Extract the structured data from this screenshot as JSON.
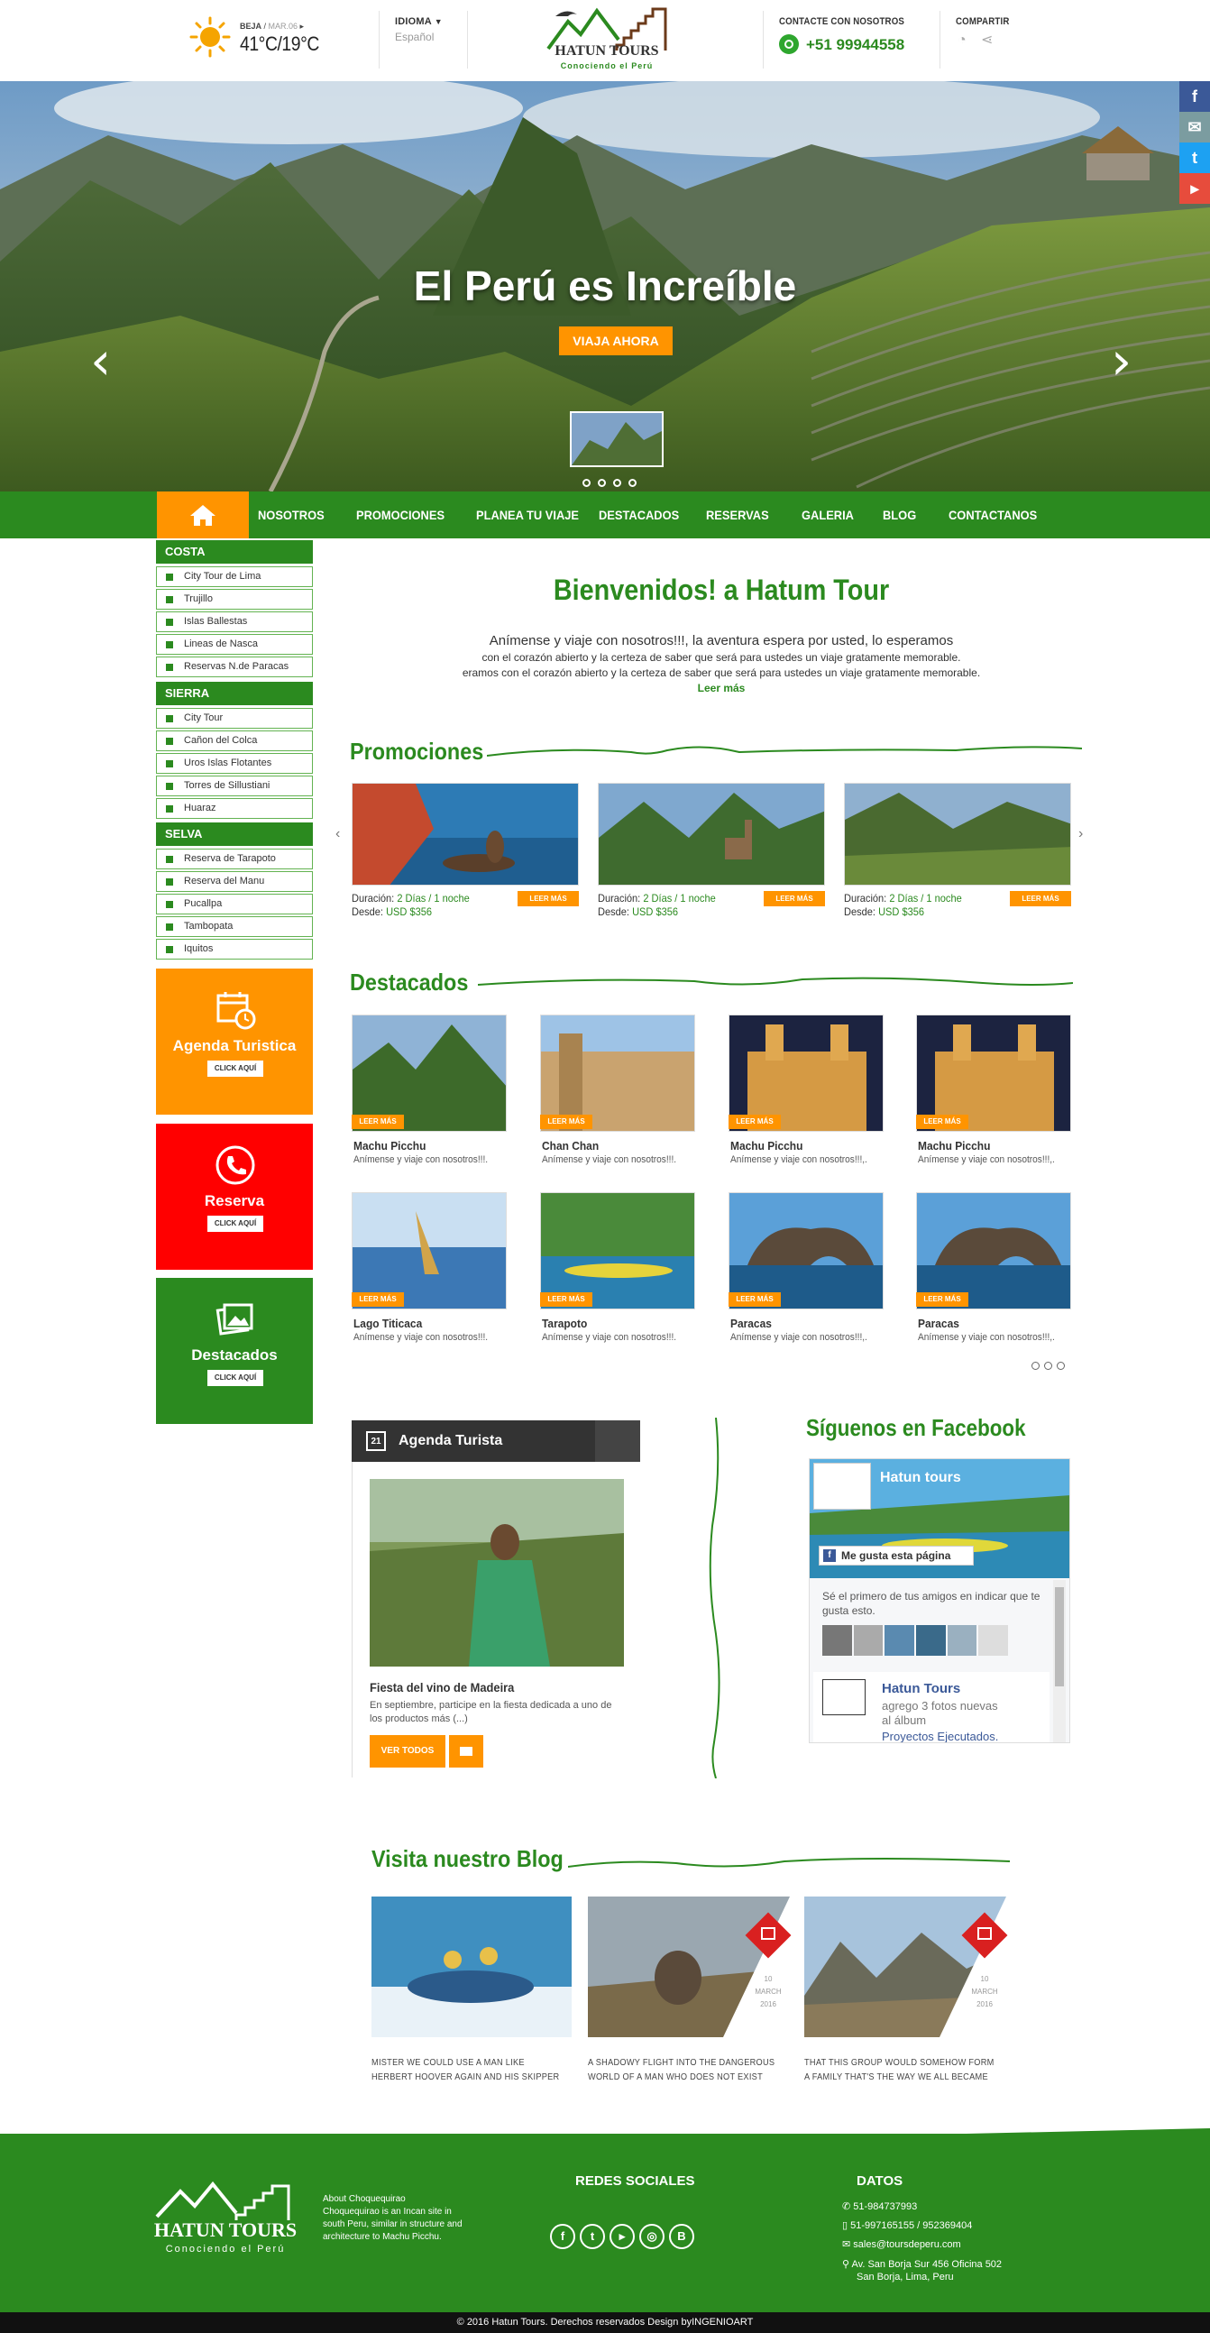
{
  "header": {
    "weather_location": "BEJA",
    "weather_date": "MAR.06",
    "weather_temp": "41°C/19°C",
    "language_label": "IDIOMA",
    "language_value": "Español",
    "logo_name": "HATUN TOURS",
    "logo_tagline": "Conociendo el Perú",
    "contact_label": "CONTACTE CON NOSOTROS",
    "contact_phone": "+51 99944558",
    "share_label": "COMPARTIR"
  },
  "hero": {
    "title": "El Perú es Increíble",
    "button": "VIAJA AHORA",
    "slides": 4
  },
  "nav": {
    "items": [
      "NOSOTROS",
      "PROMOCIONES",
      "PLANEA TU VIAJE",
      "DESTACADOS",
      "RESERVAS",
      "GALERIA",
      "BLOG",
      "CONTACTANOS"
    ]
  },
  "sidebar": {
    "sections": [
      {
        "title": "COSTA",
        "items": [
          "City Tour de Lima",
          "Trujillo",
          "Islas Ballestas",
          "Lineas de Nasca",
          "Reservas N.de Paracas"
        ]
      },
      {
        "title": "SIERRA",
        "items": [
          "City Tour",
          "Cañon del Colca",
          "Uros Islas Flotantes",
          "Torres de Sillustiani",
          "Huaraz"
        ]
      },
      {
        "title": "SELVA",
        "items": [
          "Reserva de Tarapoto",
          "Reserva del Manu",
          "Pucallpa",
          "Tambopata",
          "Iquitos"
        ]
      }
    ],
    "boxes": [
      {
        "title": "Agenda Turistica",
        "button": "CLICK AQUÍ",
        "color": "#ff9400"
      },
      {
        "title": "Reserva",
        "button": "CLICK AQUÍ",
        "color": "#ff0000"
      },
      {
        "title": "Destacados",
        "button": "CLICK AQUÍ",
        "color": "#2b8a1f"
      }
    ]
  },
  "welcome": {
    "title": "Bienvenidos! a Hatum Tour",
    "line1": "Anímense y viaje con nosotros!!!, la aventura espera por usted, lo esperamos",
    "line2": "con el corazón abierto y la certeza de saber que será para ustedes un viaje gratamente memorable.",
    "line3": "eramos con el corazón abierto y la certeza de saber que será para ustedes un viaje gratamente memorable.",
    "more": "Leer más"
  },
  "promociones": {
    "title": "Promociones",
    "items": [
      {
        "duracion_label": "Duración:",
        "duracion": "2 Días / 1 noche",
        "desde_label": "Desde:",
        "precio": "USD $356",
        "button": "LEER MÁS"
      },
      {
        "duracion_label": "Duración:",
        "duracion": "2 Días / 1 noche",
        "desde_label": "Desde:",
        "precio": "USD $356",
        "button": "LEER MÁS"
      },
      {
        "duracion_label": "Duración:",
        "duracion": "2 Días / 1 noche",
        "desde_label": "Desde:",
        "precio": "USD $356",
        "button": "LEER MÁS"
      }
    ]
  },
  "destacados": {
    "title": "Destacados",
    "items": [
      {
        "title": "Machu Picchu",
        "text": "Anímense y viaje con nosotros!!!.",
        "button": "LEER MÁS"
      },
      {
        "title": "Chan Chan",
        "text": "Anímense y viaje con nosotros!!!.",
        "button": "LEER MÁS"
      },
      {
        "title": "Machu Picchu",
        "text": "Anímense y viaje con nosotros!!!,.",
        "button": "LEER MÁS"
      },
      {
        "title": "Machu Picchu",
        "text": "Anímense y viaje con nosotros!!!,.",
        "button": "LEER MÁS"
      },
      {
        "title": "Lago Titicaca",
        "text": "Anímense y viaje con nosotros!!!.",
        "button": "LEER MÁS"
      },
      {
        "title": "Tarapoto",
        "text": "Anímense y viaje con nosotros!!!.",
        "button": "LEER MÁS"
      },
      {
        "title": "Paracas",
        "text": "Anímense y viaje con nosotros!!!,.",
        "button": "LEER MÁS"
      },
      {
        "title": "Paracas",
        "text": "Anímense y viaje con nosotros!!!,.",
        "button": "LEER MÁS"
      }
    ]
  },
  "agenda": {
    "title": "Agenda Turista",
    "day": "21",
    "event_title": "Fiesta del vino de Madeira",
    "event_text": "En septiembre, participe en la fiesta dedicada a uno de los productos más (...)",
    "button": "VER TODOS"
  },
  "facebook": {
    "title": "Síguenos en Facebook",
    "page_name": "Hatun tours",
    "like": "Me gusta esta página",
    "friends": "Sé el primero de tus amigos en indicar que te gusta esto.",
    "post_author": "Hatun Tours",
    "post_text": "agrego 3 fotos nuevas al álbum",
    "post_link": "Proyectos Ejecutados."
  },
  "blog": {
    "title": "Visita nuestro Blog",
    "posts": [
      {
        "caption": "MISTER WE COULD USE A MAN LIKE HERBERT HOOVER AGAIN AND HIS SKIPPER"
      },
      {
        "caption": "A SHADOWY FLIGHT INTO THE DANGEROUS WORLD OF A MAN WHO DOES NOT EXIST",
        "day": "10",
        "month": "MARCH",
        "year": "2016"
      },
      {
        "caption": "THAT THIS GROUP WOULD SOMEHOW FORM A FAMILY THAT'S THE WAY WE ALL BECAME",
        "day": "10",
        "month": "MARCH",
        "year": "2016"
      }
    ]
  },
  "footer": {
    "logo_name": "HATUN TOURS",
    "logo_tagline": "Conociendo el Perú",
    "about_title": "About Choquequirao",
    "about_text": "Choquequirao is an Incan site in south Peru, similar in structure and architecture to Machu Picchu.",
    "redes_title": "REDES SOCIALES",
    "datos_title": "DATOS",
    "phone1": "51-984737993",
    "phone2": "51-997165155 / 952369404",
    "email": "sales@toursdeperu.com",
    "address1": "Av. San Borja Sur 456 Oficina 502",
    "address2": "San Borja, Lima, Peru",
    "copyright": "© 2016  Hatun Tours. Derechos reservados Design byINGENIOART"
  },
  "colors": {
    "green": "#2b8a1f",
    "orange": "#ff9400",
    "red": "#ff0000"
  }
}
